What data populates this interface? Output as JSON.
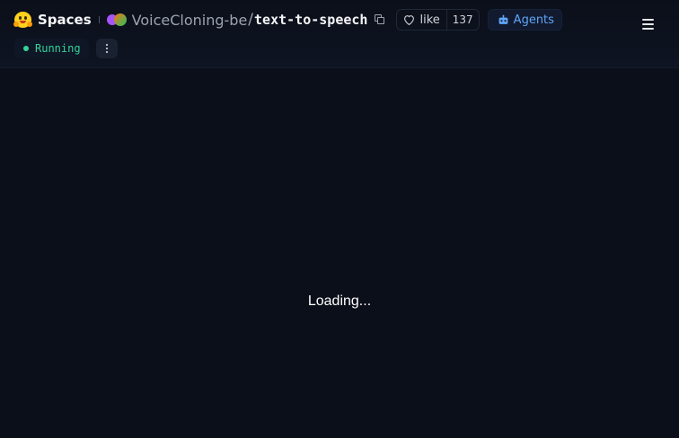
{
  "header": {
    "brand": "Spaces",
    "org": "VoiceCloning-be",
    "separator": "/",
    "repo": "text-to-speech",
    "like_label": "like",
    "like_count": "137",
    "agents_label": "Agents",
    "icons": {
      "logo": "hugging-face-logo",
      "org_avatar": "org-avatar",
      "copy": "copy-icon",
      "like": "heart-icon",
      "agents": "robot-icon",
      "menu": "hamburger-menu-icon",
      "more": "vertical-dots-icon"
    }
  },
  "status": {
    "label": "Running",
    "color": "#34d399"
  },
  "main": {
    "loading_text": "Loading..."
  },
  "colors": {
    "background": "#0b0f19",
    "accent": "#60a5fa"
  }
}
